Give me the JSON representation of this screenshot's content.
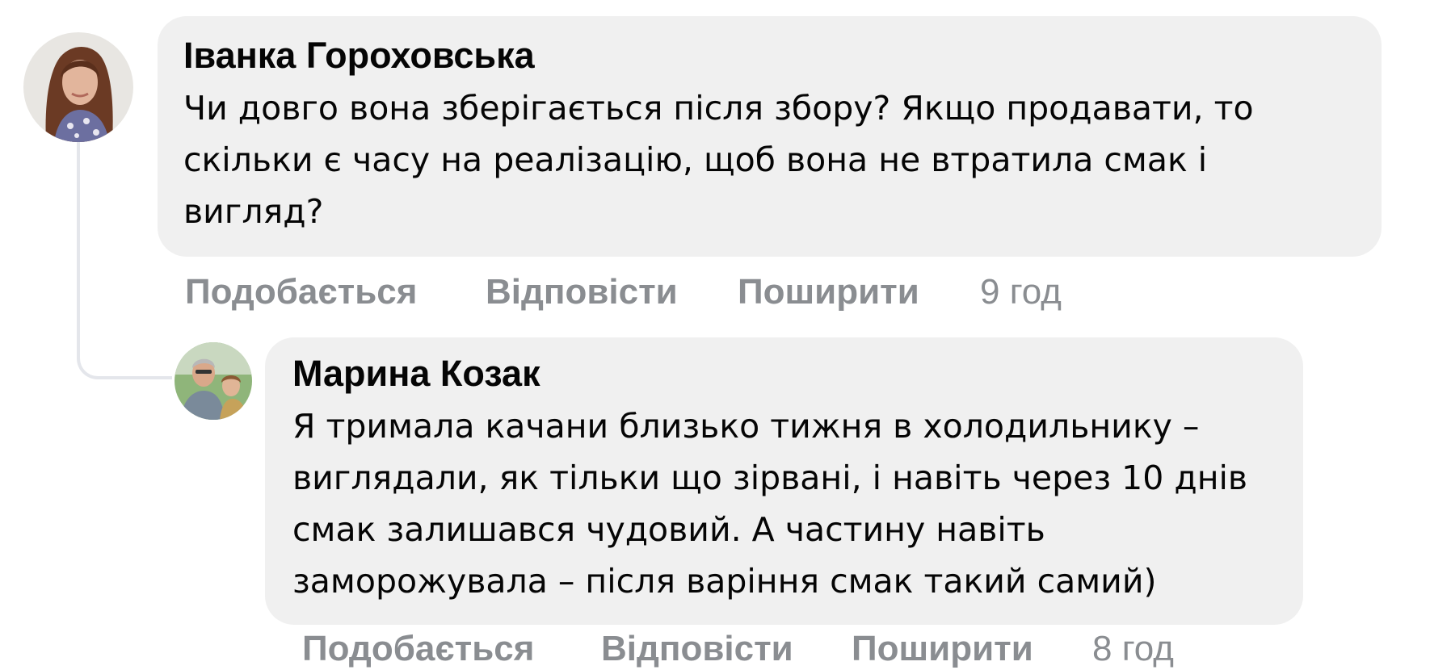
{
  "comments": [
    {
      "author": "Іванка Гороховська",
      "avatar": "woman-portrait-avatar",
      "text": "Чи довго вона зберігається після збору? Якщо продавати, то скільки є часу на реалізацію, щоб вона не втратила смак і вигляд?",
      "actions": {
        "like": "Подобається",
        "reply": "Відповісти",
        "share": "Поширити",
        "time": "9 год"
      }
    },
    {
      "author": "Марина Козак",
      "avatar": "two-people-avatar",
      "text": "Я тримала качани близько тижня в холодильнику – виглядали, як тільки що зірвані, і навіть через 10 днів смак залишався чудовий. А частину навіть заморожувала – після варіння смак такий самий)",
      "actions": {
        "like": "Подобається",
        "reply": "Відповісти",
        "share": "Поширити",
        "time": "8 год"
      }
    }
  ],
  "colors": {
    "bubble": "#f0f0f0",
    "text": "#050505",
    "meta": "#8a8d91",
    "thread_line": "#e4e6eb"
  }
}
